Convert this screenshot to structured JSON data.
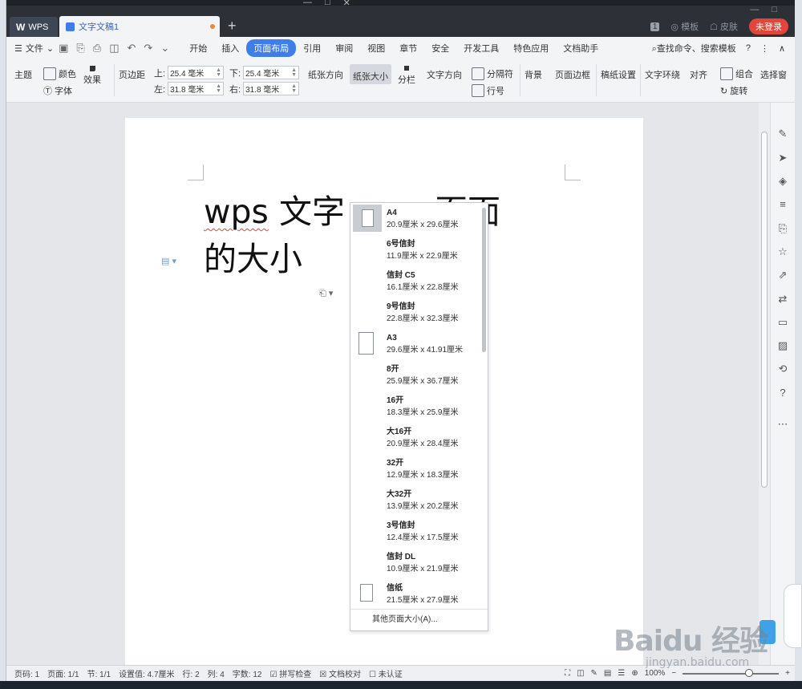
{
  "titlebar": {
    "app_tab": "WPS",
    "doc_tab": "文字文稿1",
    "add_tab": "+",
    "badge": "1",
    "templates": "模板",
    "skin": "皮肤",
    "login": "未登录"
  },
  "menubar": {
    "file": "文件",
    "items": [
      "开始",
      "插入",
      "页面布局",
      "引用",
      "审阅",
      "视图",
      "章节",
      "安全",
      "开发工具",
      "特色应用",
      "文档助手"
    ],
    "active": "页面布局",
    "search": "查找命令、搜索模板",
    "help": "?"
  },
  "ribbon": {
    "theme": "主题",
    "colors": "颜色",
    "fonts": "字体",
    "effects": "效果",
    "margins": "页边距",
    "top_label": "上:",
    "top_value": "25.4 毫米",
    "bottom_label": "下:",
    "bottom_value": "25.4 毫米",
    "left_label": "左:",
    "left_value": "31.8 毫米",
    "right_label": "右:",
    "right_value": "31.8 毫米",
    "orientation": "纸张方向",
    "paper_size": "纸张大小",
    "columns": "分栏",
    "text_direction": "文字方向",
    "breaks": "分隔符",
    "line_numbers": "行号",
    "background": "背景",
    "page_border": "页面边框",
    "grid_paper": "稿纸设置",
    "text_wrap": "文字环绕",
    "align": "对齐",
    "group": "组合",
    "rotate": "旋转",
    "selection_pane": "选择窗"
  },
  "document": {
    "line1_a": "wps",
    "line1_b": " 文字",
    "line1_c": "页面",
    "line2": "的大小"
  },
  "paper_dropdown": {
    "items": [
      {
        "name": "A4",
        "size": "20.9厘米  x  29.6厘米"
      },
      {
        "name": "6号信封",
        "size": "11.9厘米  x  22.9厘米"
      },
      {
        "name": "信封 C5",
        "size": "16.1厘米  x  22.8厘米"
      },
      {
        "name": "9号信封",
        "size": "22.8厘米  x  32.3厘米"
      },
      {
        "name": "A3",
        "size": "29.6厘米  x  41.91厘米"
      },
      {
        "name": "8开",
        "size": "25.9厘米  x  36.7厘米"
      },
      {
        "name": "16开",
        "size": "18.3厘米  x  25.9厘米"
      },
      {
        "name": "大16开",
        "size": "20.9厘米  x  28.4厘米"
      },
      {
        "name": "32开",
        "size": "12.9厘米  x  18.3厘米"
      },
      {
        "name": "大32开",
        "size": "13.9厘米  x  20.2厘米"
      },
      {
        "name": "3号信封",
        "size": "12.4厘米  x  17.5厘米"
      },
      {
        "name": "信封 DL",
        "size": "10.9厘米  x  21.9厘米"
      },
      {
        "name": "信纸",
        "size": "21.5厘米  x  27.9厘米"
      }
    ],
    "more": "其他页面大小(A)..."
  },
  "statusbar": {
    "page": "页码: 1",
    "pages": "页面: 1/1",
    "section": "节: 1/1",
    "position": "设置值: 4.7厘米",
    "row": "行: 2",
    "col": "列: 4",
    "words": "字数: 12",
    "spell": "拼写检查",
    "proof": "文档校对",
    "cert": "未认证",
    "zoom": "100%"
  },
  "watermark": {
    "main": "Baidu 经验",
    "sub": "jingyan.baidu.com"
  }
}
